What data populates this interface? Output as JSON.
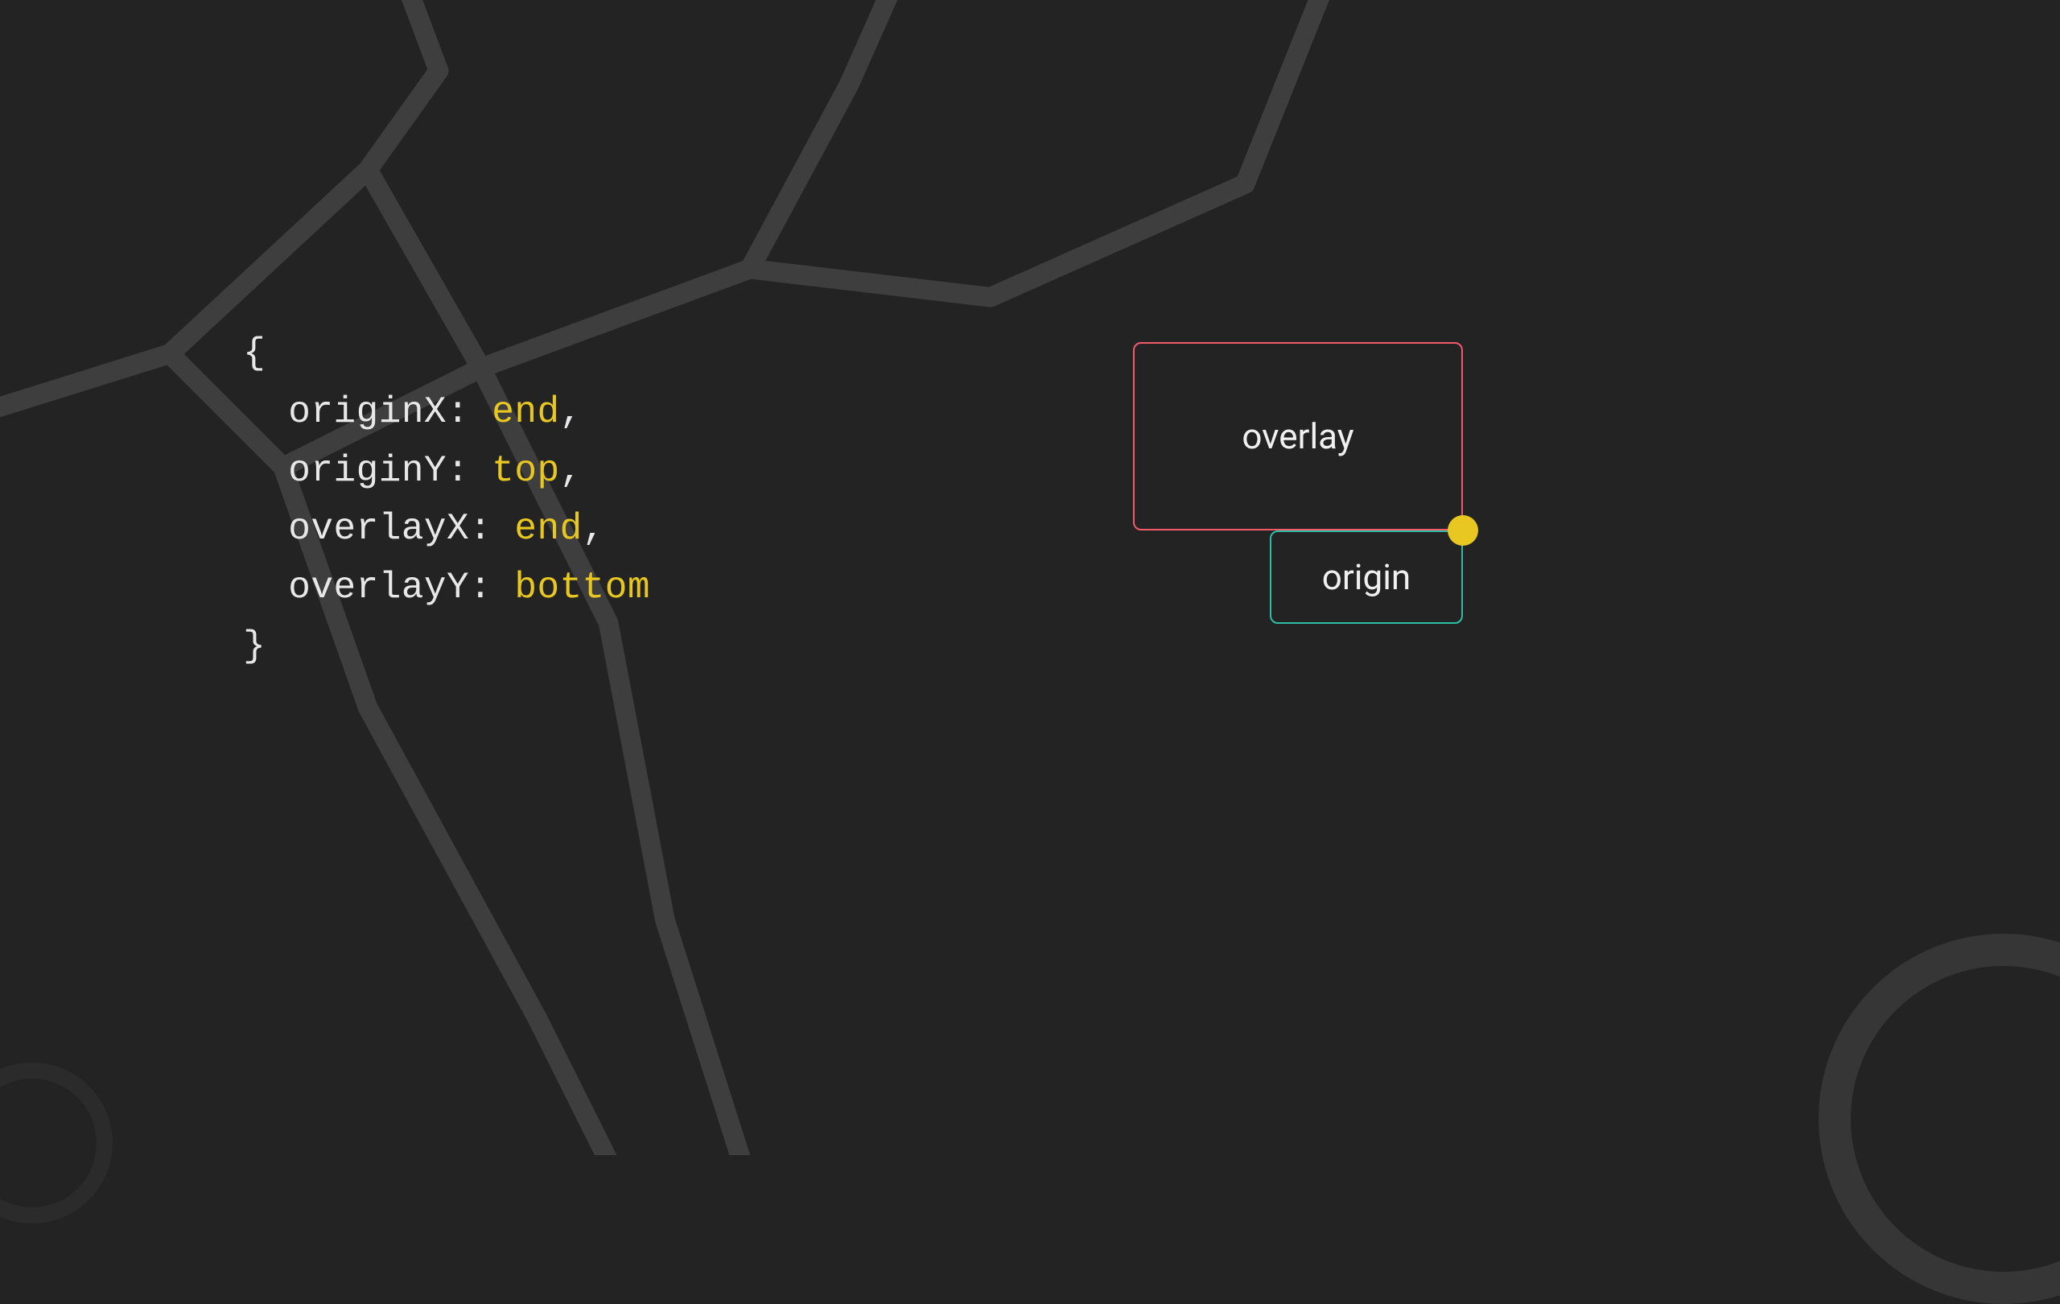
{
  "code": {
    "props": [
      {
        "key": "originX",
        "value": "end"
      },
      {
        "key": "originY",
        "value": "top"
      },
      {
        "key": "overlayX",
        "value": "end"
      },
      {
        "key": "overlayY",
        "value": "bottom"
      }
    ]
  },
  "diagram": {
    "overlay_label": "overlay",
    "origin_label": "origin"
  },
  "colors": {
    "overlay_border": "#f15b6c",
    "origin_border": "#2dbfa0",
    "dot": "#e8c820",
    "keyword": "#e8c820"
  }
}
